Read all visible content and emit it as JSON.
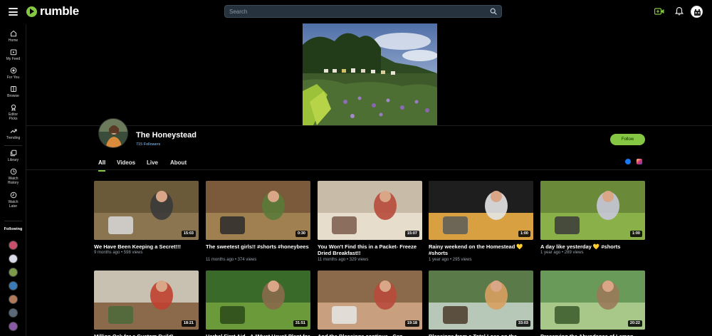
{
  "app": {
    "logo_text": "rumble"
  },
  "search": {
    "placeholder": "Search"
  },
  "sidebar": {
    "items": [
      {
        "label": "Home",
        "icon": "home-icon"
      },
      {
        "label": "My Feed",
        "icon": "feed-icon"
      },
      {
        "label": "For You",
        "icon": "for-you-icon"
      },
      {
        "label": "Browse",
        "icon": "browse-icon"
      },
      {
        "label": "Editor Picks",
        "icon": "editor-picks-icon"
      },
      {
        "label": "Trending",
        "icon": "trending-icon"
      },
      {
        "label": "Library",
        "icon": "library-icon"
      },
      {
        "label": "Watch History",
        "icon": "history-icon"
      },
      {
        "label": "Watch Later",
        "icon": "watch-later-icon"
      }
    ],
    "following_label": "Following",
    "following_colors": [
      "#c94f6a",
      "#d9d9e8",
      "#7a9a4a",
      "#3a7ab8",
      "#b07a5a",
      "#5a6a7a",
      "#8a5aa8"
    ]
  },
  "channel": {
    "name": "The Honeystead",
    "followers": "715 Followers",
    "follow_label": "Follow"
  },
  "tabs": [
    {
      "label": "All",
      "active": true
    },
    {
      "label": "Videos",
      "active": false
    },
    {
      "label": "Live",
      "active": false
    },
    {
      "label": "About",
      "active": false
    }
  ],
  "videos": [
    {
      "title": "We Have Been Keeping a Secret!!!",
      "meta": "9 months ago • 598 views",
      "duration": "15:03"
    },
    {
      "title": "The sweetest girls!! #shorts #honeybees",
      "meta": "11 months ago • 374 views",
      "duration": "0:30"
    },
    {
      "title": "You Won't Find this in a Packet- Freeze Dried Breakfast!!",
      "meta": "11 months ago • 329 views",
      "duration": "15:07"
    },
    {
      "title": "Rainy weekend on the Homestead 💛 #shorts",
      "meta": "1 year ago • 295 views",
      "duration": "1:00"
    },
    {
      "title": "A day like yesterday 💛 #shorts",
      "meta": "1 year ago • 289 views",
      "duration": "1:00"
    },
    {
      "title": "Million Oak for a Custom Build!",
      "meta": "",
      "duration": "18:21"
    },
    {
      "title": "Herbal First Aid - A \"Must Have\" Plant for",
      "meta": "",
      "duration": "31:51"
    },
    {
      "title": "And the Blessings continue - Can",
      "meta": "",
      "duration": "19:18"
    },
    {
      "title": "Blessings from a Total Loss on the",
      "meta": "",
      "duration": "33:03"
    },
    {
      "title": "Preserving the Abundance of Lemon",
      "meta": "",
      "duration": "20:22"
    }
  ],
  "colors": {
    "accent": "#85c742",
    "follower_text": "#85c7ff"
  }
}
